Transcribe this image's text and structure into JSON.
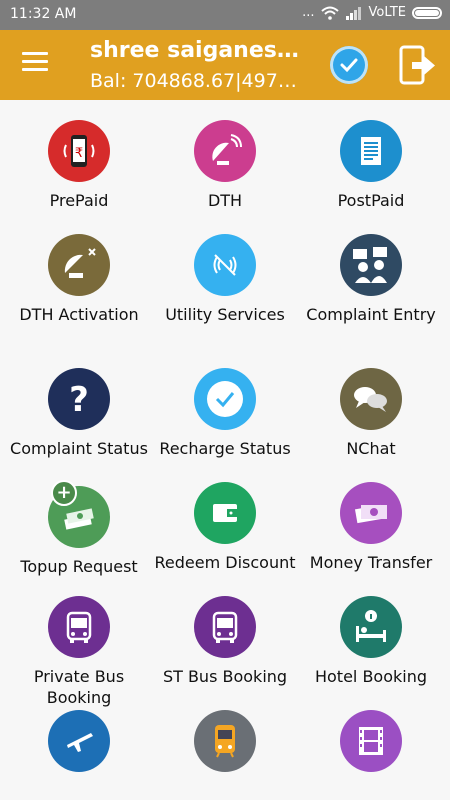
{
  "status_bar": {
    "time": "11:32 AM",
    "dots": "...",
    "network_label": "VoLTE"
  },
  "app_bar": {
    "title": "shree saiganesh...",
    "balance": "Bal: 704868.67|49747....",
    "color": "#e0a020"
  },
  "services": [
    {
      "label": "PrePaid",
      "icon": "prepaid-phone-icon",
      "color": "#d62b2b"
    },
    {
      "label": "DTH",
      "icon": "dth-dish-icon",
      "color": "#cc3d8f"
    },
    {
      "label": "PostPaid",
      "icon": "bill-icon",
      "color": "#1d8fce"
    },
    {
      "label": "DTH Activation",
      "icon": "satellite-dish-icon",
      "color": "#7a6a3a"
    },
    {
      "label": "Utility Services",
      "icon": "signal-icon",
      "color": "#35b1f0"
    },
    {
      "label": "Complaint Entry",
      "icon": "protest-icon",
      "color": "#2f4a63"
    },
    {
      "label": "Complaint Status",
      "icon": "question-icon",
      "color": "#1f2f5a"
    },
    {
      "label": "Recharge Status",
      "icon": "check-icon",
      "color": "#35b1f0"
    },
    {
      "label": "NChat",
      "icon": "chat-icon",
      "color": "#6e6644"
    },
    {
      "label": "Topup Request",
      "icon": "money-stack-icon",
      "color": "#4e9c57"
    },
    {
      "label": "Redeem Discount",
      "icon": "wallet-icon",
      "color": "#1fa561"
    },
    {
      "label": "Money Transfer",
      "icon": "cash-icon",
      "color": "#a64fbf"
    },
    {
      "label": "Private Bus Booking",
      "icon": "bus-icon",
      "color": "#6d2f91"
    },
    {
      "label": "ST Bus Booking",
      "icon": "bus-icon",
      "color": "#6d2f91"
    },
    {
      "label": "Hotel Booking",
      "icon": "hotel-bed-icon",
      "color": "#1f7a6a"
    },
    {
      "label": "",
      "icon": "airplane-icon",
      "color": "#1d6fb5"
    },
    {
      "label": "",
      "icon": "train-icon",
      "color": "#6a6f75"
    },
    {
      "label": "",
      "icon": "film-icon",
      "color": "#9b4fc3"
    }
  ]
}
